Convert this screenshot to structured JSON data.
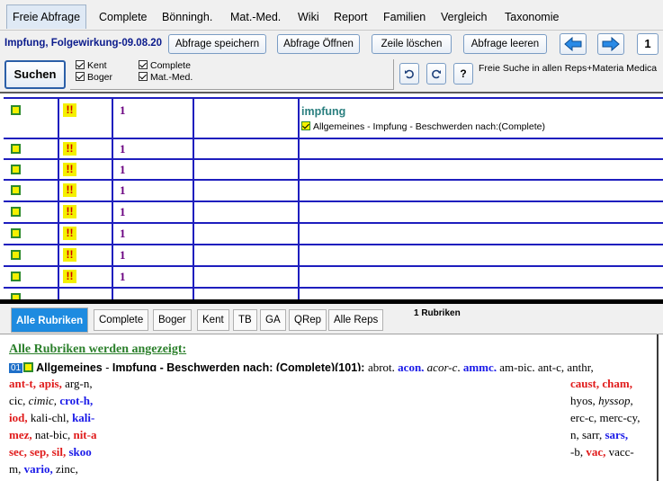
{
  "tabs": [
    "Freie Abfrage",
    "Complete",
    "Bönningh.",
    "Mat.-Med.",
    "Wiki",
    "Report",
    "Familien",
    "Vergleich",
    "Taxonomie"
  ],
  "toolbar": {
    "query_title": "Impfung, Folgewirkung-09.08.20",
    "save": "Abfrage speichern",
    "open": "Abfrage Öffnen",
    "delete_row": "Zeile löschen",
    "clear": "Abfrage leeren",
    "back_icon": "arrow-left-icon",
    "forward_icon": "arrow-right-icon",
    "page": "1"
  },
  "search": {
    "button": "Suchen",
    "checkboxes": [
      {
        "label": "Kent",
        "checked": true
      },
      {
        "label": "Boger",
        "checked": true
      },
      {
        "label": "Complete",
        "checked": true
      },
      {
        "label": "Mat.-Med.",
        "checked": true
      }
    ],
    "undo_icon": "undo-icon",
    "redo_icon": "redo-icon",
    "help": "?",
    "free_search_text": "Freie Suche in allen Reps+Materia Medica"
  },
  "grid": {
    "rows": [
      {
        "excl": "!!",
        "count": "1",
        "word": "impfung",
        "rubric": "Allgemeines - Impfung - Beschwerden nach:(Complete)"
      },
      {
        "excl": "!!",
        "count": "1",
        "word": "",
        "rubric": ""
      },
      {
        "excl": "!!",
        "count": "1",
        "word": "",
        "rubric": ""
      },
      {
        "excl": "!!",
        "count": "1",
        "word": "",
        "rubric": ""
      },
      {
        "excl": "!!",
        "count": "1",
        "word": "",
        "rubric": ""
      },
      {
        "excl": "!!",
        "count": "1",
        "word": "",
        "rubric": ""
      },
      {
        "excl": "!!",
        "count": "1",
        "word": "",
        "rubric": ""
      },
      {
        "excl": "!!",
        "count": "1",
        "word": "",
        "rubric": ""
      }
    ]
  },
  "lower_tabs": [
    "Alle Rubriken",
    "Complete",
    "Boger",
    "Kent",
    "TB",
    "GA",
    "QRep",
    "Alle Reps"
  ],
  "rubric_count": "1 Rubriken",
  "results": {
    "header": "Alle Rubriken werden angezeigt:",
    "badge": "01",
    "rubric_part1": "Allgemeines",
    "sep1": " - ",
    "rubric_part2": "Impfung - Beschwerden nach:",
    "rubric_part3": " (Complete)(101): ",
    "line1_rem": [
      {
        "t": "abrot, ",
        "s": "n"
      },
      {
        "t": "acon, ",
        "s": "b"
      },
      {
        "t": "acor-c, ",
        "s": "i"
      },
      {
        "t": "ammc, ",
        "s": "b"
      },
      {
        "t": "am-pic, ant-c, anthr,",
        "s": "n"
      }
    ],
    "line2_left": [
      {
        "t": "ant-t, ",
        "s": "r"
      },
      {
        "t": "apis, ",
        "s": "r"
      },
      {
        "t": "arg-n,",
        "s": "n"
      }
    ],
    "line2_right": [
      {
        "t": "caust, ",
        "s": "r"
      },
      {
        "t": "cham,",
        "s": "r"
      }
    ],
    "line3_left": [
      {
        "t": "cic, ",
        "s": "n"
      },
      {
        "t": "cimic, ",
        "s": "i"
      },
      {
        "t": "crot-h,",
        "s": "b"
      }
    ],
    "line3_right": [
      {
        "t": "hyos, ",
        "s": "n"
      },
      {
        "t": "hyssop,",
        "s": "i"
      }
    ],
    "line4_left": [
      {
        "t": "iod, ",
        "s": "r"
      },
      {
        "t": "kali-chl, ",
        "s": "n"
      },
      {
        "t": "kali-",
        "s": "b"
      }
    ],
    "line4_right": [
      {
        "t": "erc-c, merc-cy,",
        "s": "n"
      }
    ],
    "line5_left": [
      {
        "t": "mez, ",
        "s": "r"
      },
      {
        "t": "nat-bic, ",
        "s": "n"
      },
      {
        "t": "nit-a",
        "s": "r"
      }
    ],
    "line5_right": [
      {
        "t": "n, sarr, ",
        "s": "n"
      },
      {
        "t": "sars,",
        "s": "b"
      }
    ],
    "line6_left": [
      {
        "t": "sec, ",
        "s": "r"
      },
      {
        "t": "sep, ",
        "s": "r"
      },
      {
        "t": "sil, ",
        "s": "r"
      },
      {
        "t": "skoo",
        "s": "b"
      }
    ],
    "line6_right": [
      {
        "t": "-b, ",
        "s": "n"
      },
      {
        "t": "vac, ",
        "s": "r"
      },
      {
        "t": "vacc-",
        "s": "n"
      }
    ],
    "line7_left": [
      {
        "t": "m, ",
        "s": "n"
      },
      {
        "t": "vario, ",
        "s": "b"
      },
      {
        "t": "zinc,",
        "s": "n"
      }
    ]
  },
  "colors": {
    "accent": "#1e8be0",
    "grid_lines": "#1e1ebe",
    "remedy_red": "#e01b1b",
    "remedy_blue": "#1a1ae8"
  }
}
